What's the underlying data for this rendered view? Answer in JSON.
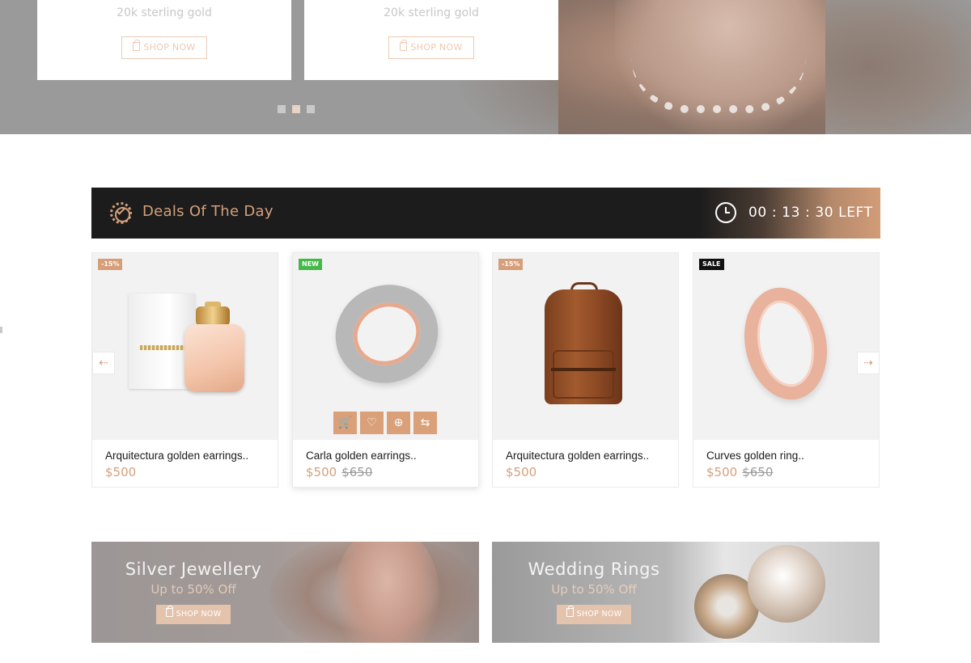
{
  "hero": {
    "cards": [
      {
        "subtitle": "20k sterling gold",
        "button": "SHOP NOW"
      },
      {
        "subtitle": "20k sterling gold",
        "button": "SHOP NOW"
      }
    ],
    "active_slide": 2,
    "slide_count": 3
  },
  "deals": {
    "title": "Deals Of The Day",
    "countdown": "00 : 13 : 30 LEFT"
  },
  "products": [
    {
      "name": "Arquitectura golden earrings..",
      "price": "$500",
      "old_price": "",
      "tag": "-15%",
      "image": "perfume"
    },
    {
      "name": "Carla golden earrings..",
      "price": "$500",
      "old_price": "$650",
      "tag": "NEW",
      "image": "silver-rose-ring"
    },
    {
      "name": "Arquitectura golden earrings..",
      "price": "$500",
      "old_price": "",
      "tag": "-15%",
      "image": "leather-backpack"
    },
    {
      "name": "Curves golden ring..",
      "price": "$500",
      "old_price": "$650",
      "tag": "SALE",
      "image": "rose-gold-ring"
    }
  ],
  "product_actions": [
    "cart-icon",
    "heart-icon",
    "zoom-icon",
    "compare-icon"
  ],
  "banners": [
    {
      "title": "Silver Jewellery",
      "subtitle": "Up to 50% Off",
      "button": "SHOP NOW"
    },
    {
      "title": "Wedding Rings",
      "subtitle": "Up to 50% Off",
      "button": "SHOP NOW"
    }
  ],
  "colors": {
    "accent": "#d5a07b",
    "dark_bar": "#1c1c1c",
    "new_tag": "#46b84a",
    "sale_tag": "#111111"
  }
}
